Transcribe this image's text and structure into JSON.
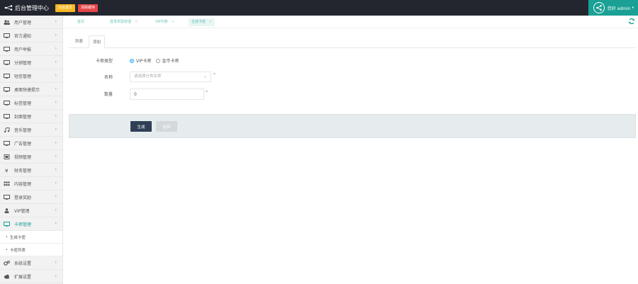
{
  "header": {
    "title": "后台管理中心",
    "btn_home": "前台首页",
    "btn_clear": "清除缓存",
    "user_text": "您好 admin"
  },
  "sidebar": {
    "items": [
      {
        "label": "用户管理",
        "icon": "users-icon"
      },
      {
        "label": "官方通知",
        "icon": "monitor-icon"
      },
      {
        "label": "用户举报",
        "icon": "monitor-icon"
      },
      {
        "label": "分销管理",
        "icon": "monitor-icon"
      },
      {
        "label": "短信管理",
        "icon": "monitor-icon"
      },
      {
        "label": "桌面快捷提示",
        "icon": "monitor-icon"
      },
      {
        "label": "标签管理",
        "icon": "monitor-icon"
      },
      {
        "label": "封面管理",
        "icon": "monitor-icon"
      },
      {
        "label": "音乐管理",
        "icon": "music-icon"
      },
      {
        "label": "广告管理",
        "icon": "monitor-icon"
      },
      {
        "label": "视频管理",
        "icon": "video-icon"
      },
      {
        "label": "财务管理",
        "icon": "yen-icon"
      },
      {
        "label": "内容管理",
        "icon": "grid-icon"
      },
      {
        "label": "登录奖励",
        "icon": "monitor-icon"
      },
      {
        "label": "VIP管理",
        "icon": "user-icon"
      },
      {
        "label": "卡密管理",
        "icon": "monitor-icon",
        "active": true
      }
    ],
    "sub_items": [
      "生成卡密",
      "卡密列表"
    ],
    "bottom_items": [
      {
        "label": "系统设置",
        "icon": "gears-icon"
      },
      {
        "label": "扩展设置",
        "icon": "cloud-icon"
      }
    ]
  },
  "tabs": [
    {
      "label": "首页"
    },
    {
      "label": "登录奖励管理"
    },
    {
      "label": "VIP列表"
    },
    {
      "label": "生成卡密"
    }
  ],
  "inner_tabs": [
    "列表",
    "添加"
  ],
  "form": {
    "type_label": "卡密类型",
    "type_options": [
      "VIP卡密",
      "金币卡密"
    ],
    "name_label": "名称",
    "name_placeholder": "请选择分类名称",
    "qty_label": "数量",
    "qty_value": "0",
    "submit": "生成",
    "back": "返回"
  },
  "colors": {
    "topbar": "#23262e",
    "accent": "#1aa094",
    "home_btn": "#f7b824",
    "clear_btn": "#e64547",
    "submit_btn": "#2f4056"
  }
}
